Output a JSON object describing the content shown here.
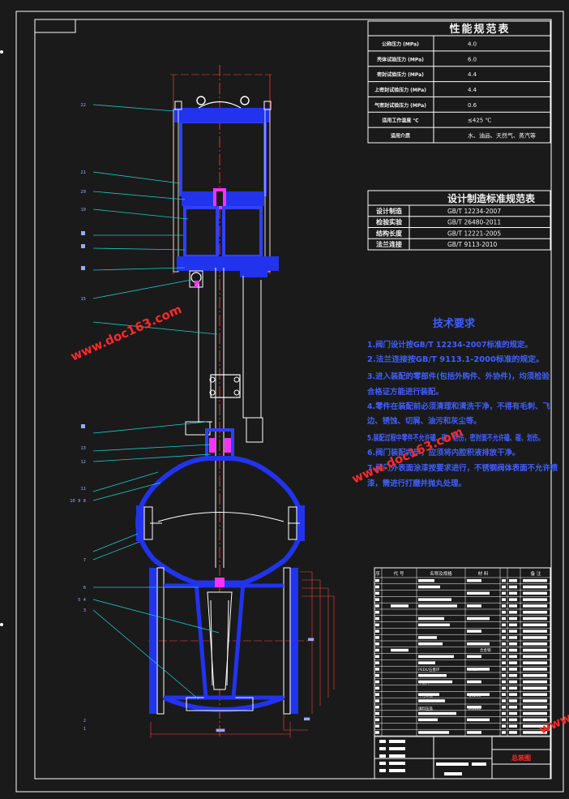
{
  "perf_table": {
    "title": "性能规范表",
    "rows": [
      {
        "label": "公称压力 (MPa)",
        "value": "4.0"
      },
      {
        "label": "壳体试验压力 (MPa)",
        "value": "6.0"
      },
      {
        "label": "密封试验压力 (MPa)",
        "value": "4.4"
      },
      {
        "label": "上密封试验压力 (MPa)",
        "value": "4.4"
      },
      {
        "label": "气密封试验压力 (MPa)",
        "value": "0.6"
      },
      {
        "label": "适用工作温度 ℃",
        "value": "≤425 ℃"
      },
      {
        "label": "适用介质",
        "value": "水、油品、天然气、蒸汽等"
      }
    ]
  },
  "std_table": {
    "title": "设计制造标准规范表",
    "rows": [
      {
        "label": "设计制造",
        "value": "GB/T 12234-2007"
      },
      {
        "label": "检验实验",
        "value": "GB/T 26480-2011"
      },
      {
        "label": "结构长度",
        "value": "GB/T 12221-2005"
      },
      {
        "label": "法兰连接",
        "value": "GB/T 9113-2010"
      }
    ]
  },
  "tech": {
    "title": "技术要求",
    "lines": [
      "1.阀门设计按GB/T 12234-2007标准的规定。",
      "2.法兰连接按GB/T 9113.1-2000标准的规定。",
      "3.进入装配的零部件(包括外购件、外协件)，均须检验",
      "合格证方能进行装配。",
      "4.零件在装配前必须清理和清洗干净，不得有毛刺、飞",
      "边、锈蚀、切屑、油污和灰尘等。",
      "5.装配过程中零件不允许磕、碰、划伤，密封面不允许磕、碰、划伤。",
      "6.阀门装配完毕，应须将内腔积液排放干净。",
      "7.阀门外表面涂漆按要求进行，不锈钢阀体表面不允许喷",
      "漆，需进行打磨并抛丸处理。"
    ]
  },
  "bom": {
    "headers": [
      "序",
      "代 号",
      "名称及规格",
      "材 料",
      "备 注"
    ],
    "visible_entries": [
      "合金钢",
      "PEEK/石墨环",
      "平垫片",
      "WCB",
      "平行焊盘",
      "QC235",
      "填料压盖",
      "ZG400"
    ]
  },
  "title_block": {
    "drawing_title": "总装图"
  },
  "part_labels": [
    "22",
    "21",
    "20",
    "19",
    "15",
    "13",
    "12",
    "11",
    "10 9 8",
    "7",
    "6",
    "5 4",
    "3",
    "2",
    "1"
  ],
  "watermark": "www.doc163.com",
  "colors": {
    "background": "#1a1a1a",
    "frame": "#ffffff",
    "body_outline": "#3040ff",
    "leader": "#20c8c8",
    "seal": "#ff30ff",
    "tech_title": "#3f5fff",
    "watermark": "#ff2a2a"
  }
}
